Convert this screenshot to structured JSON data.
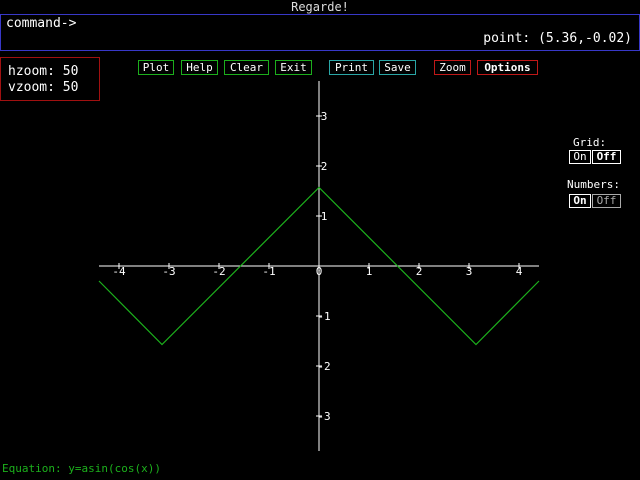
{
  "window": {
    "title": "Regarde!"
  },
  "command": {
    "prompt": "command->",
    "point_label": "point:",
    "point_value": "(5.36,-0.02)"
  },
  "zoom": {
    "hzoom_label": "hzoom:",
    "hzoom_value": "50",
    "vzoom_label": "vzoom:",
    "vzoom_value": "50"
  },
  "toolbar": {
    "plot": "Plot",
    "help": "Help",
    "clear": "Clear",
    "exit": "Exit",
    "print": "Print",
    "save": "Save",
    "zoom": "Zoom",
    "options": "Options"
  },
  "options": {
    "grid_label": "Grid:",
    "grid_on": "On",
    "grid_off": "Off",
    "numbers_label": "Numbers:",
    "numbers_on": "On",
    "numbers_off": "Off"
  },
  "equation": {
    "label": "Equation:",
    "expression": "y=asin(cos(x))"
  },
  "colors": {
    "axis": "#ffffff",
    "curve": "#1cb01c",
    "green_border": "#1cae1c",
    "red_border": "#c01818",
    "blue_border": "#3838c8"
  },
  "chart_data": {
    "type": "line",
    "title": "",
    "xlabel": "",
    "ylabel": "",
    "xlim": [
      -4.4,
      4.4
    ],
    "ylim": [
      -3.6,
      3.6
    ],
    "x_ticks": [
      -4,
      -3,
      -2,
      -1,
      0,
      1,
      2,
      3,
      4
    ],
    "y_ticks": [
      -3,
      -2,
      -1,
      1,
      2,
      3
    ],
    "x_tick_labels": [
      "-4",
      "-3",
      "-2",
      "-1",
      "0",
      "1",
      "2",
      "3",
      "4"
    ],
    "y_tick_labels": [
      "-3",
      "-2",
      "-1",
      "1",
      "2",
      "3"
    ],
    "grid": false,
    "series": [
      {
        "x": [
          -4.4,
          -3.14,
          0,
          3.14,
          4.4
        ],
        "y": [
          -0.3,
          -1.57,
          1.57,
          -1.57,
          -0.3
        ]
      }
    ]
  }
}
